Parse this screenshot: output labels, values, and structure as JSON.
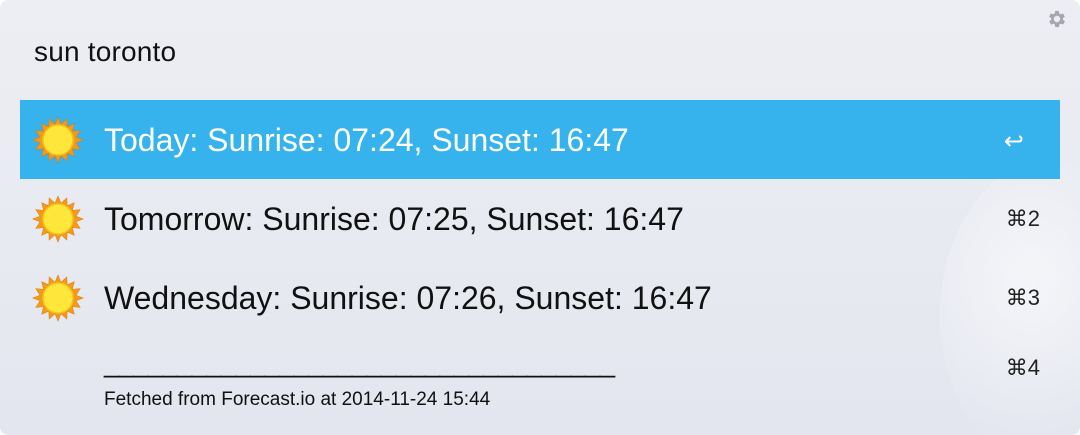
{
  "query": "sun toronto",
  "settings_icon": "gear-icon",
  "accent_color": "#36b2ec",
  "results": [
    {
      "icon": "sun-icon",
      "title": "Today: Sunrise: 07:24, Sunset: 16:47",
      "shortcut": "↩",
      "selected": true
    },
    {
      "icon": "sun-icon",
      "title": "Tomorrow: Sunrise: 07:25, Sunset: 16:47",
      "shortcut": "⌘2",
      "selected": false
    },
    {
      "icon": "sun-icon",
      "title": "Wednesday: Sunrise: 07:26, Sunset: 16:47",
      "shortcut": "⌘3",
      "selected": false
    }
  ],
  "footer": {
    "title": "___________________________________",
    "subtitle": "Fetched from Forecast.io at 2014-11-24 15:44",
    "shortcut": "⌘4"
  }
}
